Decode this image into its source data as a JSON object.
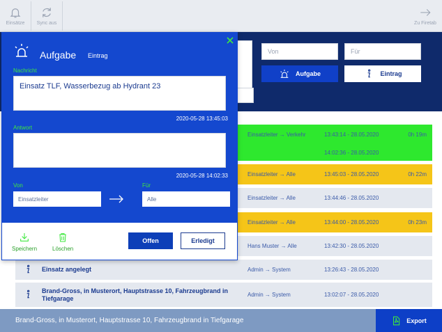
{
  "topbar": {
    "einsaetze_label": "Einsätze",
    "sync_label": "Sync aus",
    "firetab_label": "Zu Firetab"
  },
  "header": {
    "von_placeholder": "Von",
    "fuer_placeholder": "Für",
    "aufgabe_button": "Aufgabe",
    "eintrag_button": "Eintrag"
  },
  "rows": [
    {
      "title": "",
      "route": "Einsatzleiter → Verkehr",
      "time": "13:43:14 - 28.05.2020",
      "duration": "0h 19m",
      "status": "green"
    },
    {
      "title": "",
      "route": "",
      "time": "14:02:36 - 28.05.2020",
      "duration": "",
      "status": "green"
    },
    {
      "title": "",
      "route": "Einsatzleiter → Alle",
      "time": "13:45:03 - 28.05.2020",
      "duration": "0h 22m",
      "status": "yellow"
    },
    {
      "title": "",
      "route": "Einsatzleiter → Alle",
      "time": "13:44:46 - 28.05.2020",
      "duration": "",
      "status": "grey"
    },
    {
      "title": "",
      "route": "Einsatzleiter → Alle",
      "time": "13:44:00 - 28.05.2020",
      "duration": "0h 23m",
      "status": "yellow"
    },
    {
      "title": "",
      "route": "Hans Muster → Alle",
      "time": "13:42:30 - 28.05.2020",
      "duration": "",
      "status": "grey"
    },
    {
      "title": "Einsatz angelegt",
      "route": "Admin → System",
      "time": "13:26:43 - 28.05.2020",
      "duration": "",
      "status": "grey"
    },
    {
      "title": "Brand-Gross, in Musterort, Hauptstrasse 10, Fahrzeugbrand in Tiefgarage",
      "route": "Admin → System",
      "time": "13:02:07 - 28.05.2020",
      "duration": "",
      "status": "grey"
    }
  ],
  "footer": {
    "text": "Brand-Gross, in Musterort, Hauptstrasse 10, Fahrzeugbrand in Tiefgarage",
    "export_label": "Export"
  },
  "dialog": {
    "title": "Aufgabe",
    "subtitle": "Eintrag",
    "nachricht_label": "Nachricht",
    "nachricht_value": "Einsatz TLF, Wasserbezug ab Hydrant 23",
    "nachricht_stamp": "2020-05-28 13:45:03",
    "antwort_label": "Antwort",
    "antwort_value": "",
    "antwort_stamp": "2020-05-28 14:02:33",
    "von_label": "Von",
    "von_value": "Einsatzleiter",
    "fuer_label": "Für",
    "fuer_value": "Alle",
    "speichern_label": "Speichern",
    "loeschen_label": "Löschen",
    "offen_label": "Offen",
    "erledigt_label": "Erledigt"
  },
  "colors": {
    "header_bg": "#0f2a6b",
    "dialog_bg": "#1448cf",
    "green": "#2ee82e",
    "yellow": "#f5c518",
    "grey_row": "#e4e8ef",
    "footer_bg": "#7e9ac2",
    "export_bg": "#0d3fc7"
  }
}
